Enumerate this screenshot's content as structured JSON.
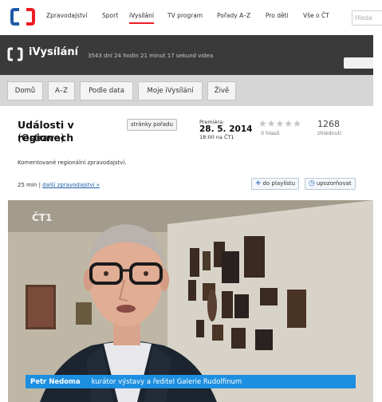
{
  "topnav": {
    "items": [
      "Zpravodajství",
      "Sport",
      "iVysílání",
      "TV program",
      "Pořady A–Z",
      "Pro děti",
      "Vše o ČT"
    ],
    "active_index": 2,
    "search_placeholder": "Hleda"
  },
  "header": {
    "title": "iVysílání",
    "stats": "3543 dní 24 hodin 21 minut 17 sekund videa"
  },
  "tabs": [
    "Domů",
    "A–Z",
    "Podle data",
    "Moje iVysílání",
    "Živě"
  ],
  "program": {
    "title": "Události v regionech",
    "subtitle": "(Ostrava)",
    "pages_button": "stránky pořadu",
    "premiere_label": "Premiéra:",
    "premiere_date": "28. 5. 2014",
    "premiere_time": "18:00 na ČT1",
    "rating_stars": 0,
    "votes": "0 hlasů",
    "views": "1268",
    "views_label": "zhlédnutí",
    "description": "Komentované regionální zpravodajství.",
    "duration": "25 min",
    "separator": "|",
    "more_link": "další zpravodajství »",
    "playlist_button": "do playlistu",
    "notify_button": "upozorňovat"
  },
  "video": {
    "channel_watermark": "ČT1",
    "lower_third_name": "Petr Nedoma",
    "lower_third_role": "kurátor výstavy a ředitel Galerie Rudolfinum"
  },
  "colors": {
    "brand_red": "#ed1c24",
    "brand_blue": "#1e5aa6",
    "header_dark": "#3a3a3a",
    "tab_band": "#d6d6d6",
    "lower_third": "#1d8fe0"
  }
}
